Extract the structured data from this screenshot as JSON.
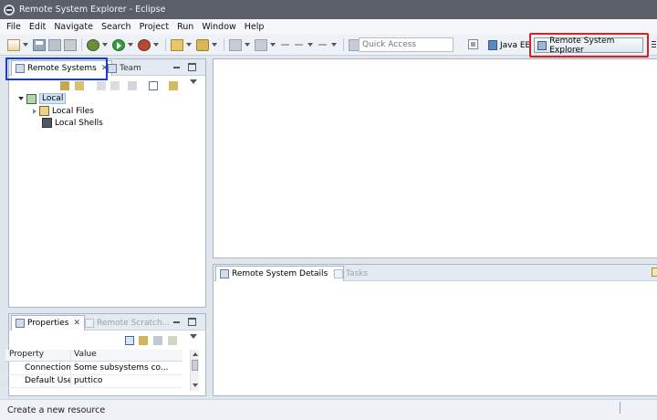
{
  "window": {
    "title": "Remote System Explorer - Eclipse"
  },
  "menubar": {
    "items": [
      "File",
      "Edit",
      "Navigate",
      "Search",
      "Project",
      "Run",
      "Window",
      "Help"
    ]
  },
  "toolbar": {
    "quick_access_placeholder": "Quick Access",
    "perspectives": {
      "java_ee": "Java EE",
      "rse": "Remote System Explorer"
    }
  },
  "left_panel": {
    "tabs": {
      "remote_systems": "Remote Systems",
      "team": "Team"
    },
    "tree": {
      "local": "Local",
      "local_files": "Local Files",
      "local_shells": "Local Shells"
    }
  },
  "bottom_panel": {
    "tabs": {
      "details": "Remote System Details",
      "tasks": "Tasks"
    }
  },
  "properties_panel": {
    "tabs": {
      "properties": "Properties",
      "scratchpad": "Remote Scratch..."
    },
    "columns": {
      "property": "Property",
      "value": "Value"
    },
    "rows": [
      {
        "property": "Connection",
        "value": "Some subsystems co..."
      },
      {
        "property": "Default User",
        "value": "puttico"
      }
    ]
  },
  "statusbar": {
    "message": "Create a new resource"
  }
}
